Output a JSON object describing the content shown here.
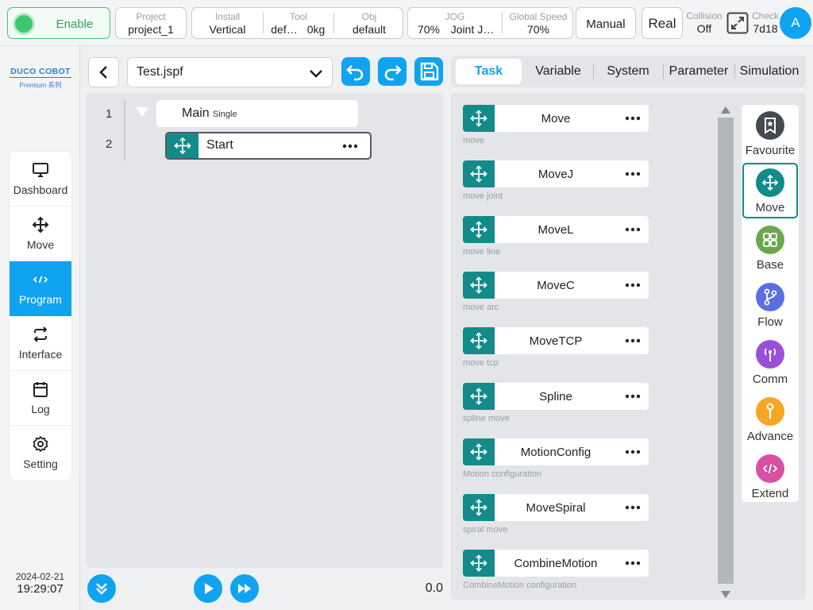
{
  "topbar": {
    "enable_label": "Enable",
    "project": {
      "label": "Project",
      "value": "project_1"
    },
    "install": {
      "label": "Install",
      "value": "Vertical"
    },
    "tool": {
      "label": "Tool",
      "value": "def…",
      "value2": "0kg"
    },
    "obj": {
      "label": "Obj",
      "value": "default"
    },
    "jog": {
      "label": "JOG",
      "value": "70%",
      "value2": "Joint J…"
    },
    "global_speed": {
      "label": "Global Speed",
      "value": "70%"
    },
    "mode": "Manual",
    "real": "Real",
    "collision": {
      "label": "Collision",
      "value": "Off"
    },
    "check": {
      "label": "Check",
      "value": "7d18"
    },
    "avatar": "A"
  },
  "logo": {
    "brand": "DUCO COBOT",
    "sub": "Premium 系列"
  },
  "nav": [
    {
      "label": "Dashboard",
      "icon": "monitor-icon"
    },
    {
      "label": "Move",
      "icon": "move-arrows-icon"
    },
    {
      "label": "Program",
      "icon": "code-icon"
    },
    {
      "label": "Interface",
      "icon": "swap-icon"
    },
    {
      "label": "Log",
      "icon": "calendar-icon"
    },
    {
      "label": "Setting",
      "icon": "gear-icon"
    }
  ],
  "datetime": {
    "date": "2024-02-21",
    "time": "19:29:07"
  },
  "editor": {
    "file": "Test.jspf",
    "lines": [
      {
        "num": "1",
        "label": "Main",
        "tag": "Single"
      },
      {
        "num": "2",
        "label": "Start"
      }
    ],
    "speed_value": "0.0"
  },
  "tabs": [
    "Task",
    "Variable",
    "System",
    "Parameter",
    "Simulation"
  ],
  "commands": [
    {
      "name": "Move",
      "desc": "move"
    },
    {
      "name": "MoveJ",
      "desc": "move joint"
    },
    {
      "name": "MoveL",
      "desc": "move line"
    },
    {
      "name": "MoveC",
      "desc": "move arc"
    },
    {
      "name": "MoveTCP",
      "desc": "move tcp"
    },
    {
      "name": "Spline",
      "desc": "spline move"
    },
    {
      "name": "MotionConfig",
      "desc": "Motion configuration"
    },
    {
      "name": "MoveSpiral",
      "desc": "spiral move"
    },
    {
      "name": "CombineMotion",
      "desc": "CombineMotion configuration"
    }
  ],
  "categories": [
    {
      "label": "Favourite",
      "color": "#454a50",
      "icon": "bookmark-icon"
    },
    {
      "label": "Move",
      "color": "#128b8a",
      "icon": "move-arrows-icon"
    },
    {
      "label": "Base",
      "color": "#6aa84f",
      "icon": "grid-icon"
    },
    {
      "label": "Flow",
      "color": "#5b6ee1",
      "icon": "branch-icon"
    },
    {
      "label": "Comm",
      "color": "#9b4fd6",
      "icon": "antenna-icon"
    },
    {
      "label": "Advance",
      "color": "#f5a623",
      "icon": "wrench-icon"
    },
    {
      "label": "Extend",
      "color": "#d84fa3",
      "icon": "code-icon"
    }
  ],
  "colors": {
    "accent": "#0fa3f0",
    "teal": "#128b8a",
    "enable_green": "#3dc86e"
  }
}
